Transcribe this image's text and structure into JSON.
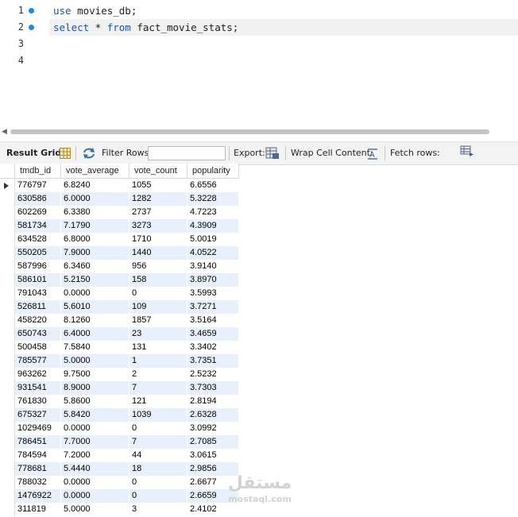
{
  "editor": {
    "lines": [
      {
        "num": "1",
        "kw": "use",
        "rest": " movies_db;"
      },
      {
        "num": "2",
        "kw": "select",
        "mid": " * ",
        "kw2": "from",
        "rest": " fact_movie_stats;"
      },
      {
        "num": "3"
      },
      {
        "num": "4"
      }
    ]
  },
  "toolbar": {
    "result_grid": "Result Grid",
    "filter_rows": "Filter Rows:",
    "filter_value": "",
    "export": "Export:",
    "wrap_cell": "Wrap Cell Content:",
    "fetch_rows": "Fetch rows:"
  },
  "grid": {
    "columns": [
      "tmdb_id",
      "vote_average",
      "vote_count",
      "popularity"
    ],
    "rows": [
      [
        "776797",
        "6.8240",
        "1055",
        "6.6556"
      ],
      [
        "630586",
        "6.0000",
        "1282",
        "5.3228"
      ],
      [
        "602269",
        "6.3380",
        "2737",
        "4.7223"
      ],
      [
        "581734",
        "7.1790",
        "3273",
        "4.3909"
      ],
      [
        "634528",
        "6.8000",
        "1710",
        "5.0019"
      ],
      [
        "550205",
        "7.9000",
        "1440",
        "4.0522"
      ],
      [
        "587996",
        "6.3460",
        "956",
        "3.9140"
      ],
      [
        "586101",
        "5.2150",
        "158",
        "3.8970"
      ],
      [
        "791043",
        "0.0000",
        "0",
        "3.5993"
      ],
      [
        "526811",
        "5.6010",
        "109",
        "3.7271"
      ],
      [
        "458220",
        "8.1260",
        "1857",
        "3.5164"
      ],
      [
        "650743",
        "6.4000",
        "23",
        "3.4659"
      ],
      [
        "500458",
        "7.5840",
        "131",
        "3.3402"
      ],
      [
        "785577",
        "5.0000",
        "1",
        "3.7351"
      ],
      [
        "963262",
        "9.7500",
        "2",
        "2.5232"
      ],
      [
        "931541",
        "8.9000",
        "7",
        "3.7303"
      ],
      [
        "761830",
        "5.8600",
        "121",
        "2.8194"
      ],
      [
        "675327",
        "5.8420",
        "1039",
        "2.6328"
      ],
      [
        "1029469",
        "0.0000",
        "0",
        "3.0992"
      ],
      [
        "786451",
        "7.7000",
        "7",
        "2.7085"
      ],
      [
        "784594",
        "7.2000",
        "44",
        "3.0615"
      ],
      [
        "778681",
        "5.4440",
        "18",
        "2.9856"
      ],
      [
        "788032",
        "0.0000",
        "0",
        "2.6677"
      ],
      [
        "1476922",
        "0.0000",
        "0",
        "2.6659"
      ],
      [
        "311819",
        "5.0000",
        "3",
        "2.4102"
      ]
    ]
  },
  "watermark": {
    "arabic": "مستقل",
    "latin": "mostaql.com"
  },
  "colors": {
    "keyword": "#1a52c4",
    "breakpoint": "#1e86e8",
    "alt_row": "#e8f1fb"
  }
}
